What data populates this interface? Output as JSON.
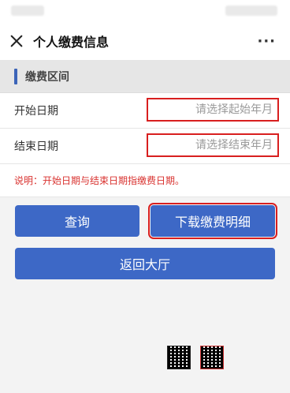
{
  "nav": {
    "title": "个人缴费信息",
    "more_label": "···"
  },
  "section": {
    "title": "缴费区间"
  },
  "form": {
    "start": {
      "label": "开始日期",
      "placeholder": "请选择起始年月"
    },
    "end": {
      "label": "结束日期",
      "placeholder": "请选择结束年月"
    },
    "note": "说明：开始日期与结束日期指缴费日期。"
  },
  "buttons": {
    "query": "查询",
    "download": "下载缴费明细",
    "back": "返回大厅"
  },
  "colors": {
    "accent": "#3d68c6",
    "highlight": "#d81f1f",
    "note": "#d9322f"
  },
  "icons": {
    "close": "close-icon",
    "more": "more-icon"
  }
}
